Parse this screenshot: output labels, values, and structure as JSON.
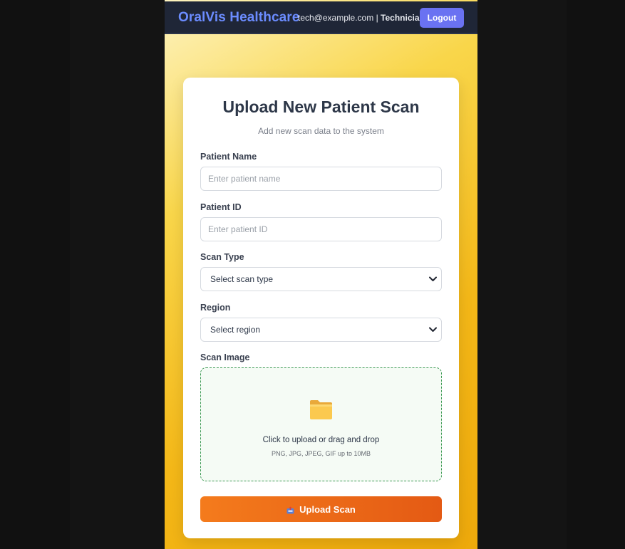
{
  "navbar": {
    "brand": "OralVis Healthcare",
    "user_email": "tech@example.com",
    "separator": " | ",
    "user_role": "Technician",
    "logout_label": "Logout"
  },
  "form": {
    "title": "Upload New Patient Scan",
    "subtitle": "Add new scan data to the system",
    "patient_name": {
      "label": "Patient Name",
      "value": "",
      "placeholder": "Enter patient name"
    },
    "patient_id": {
      "label": "Patient ID",
      "value": "",
      "placeholder": "Enter patient ID"
    },
    "scan_type": {
      "label": "Scan Type",
      "selected": "Select scan type"
    },
    "region": {
      "label": "Region",
      "selected": "Select region"
    },
    "scan_image": {
      "label": "Scan Image",
      "dropzone_text": "Click to upload or drag and drop",
      "dropzone_hint": "PNG, JPG, JPEG, GIF up to 10MB",
      "icon": "folder-icon"
    },
    "submit_label": "Upload Scan",
    "submit_icon": "inbox-tray-icon"
  },
  "colors": {
    "navbar_bg": "#1f2637",
    "brand": "#6b8cff",
    "logout_bg": "#6a72f2",
    "submit_start": "#f47b1c",
    "submit_end": "#e45a14",
    "dropzone_border": "#3d9a54",
    "background_gradient_end": "#eea90b"
  }
}
